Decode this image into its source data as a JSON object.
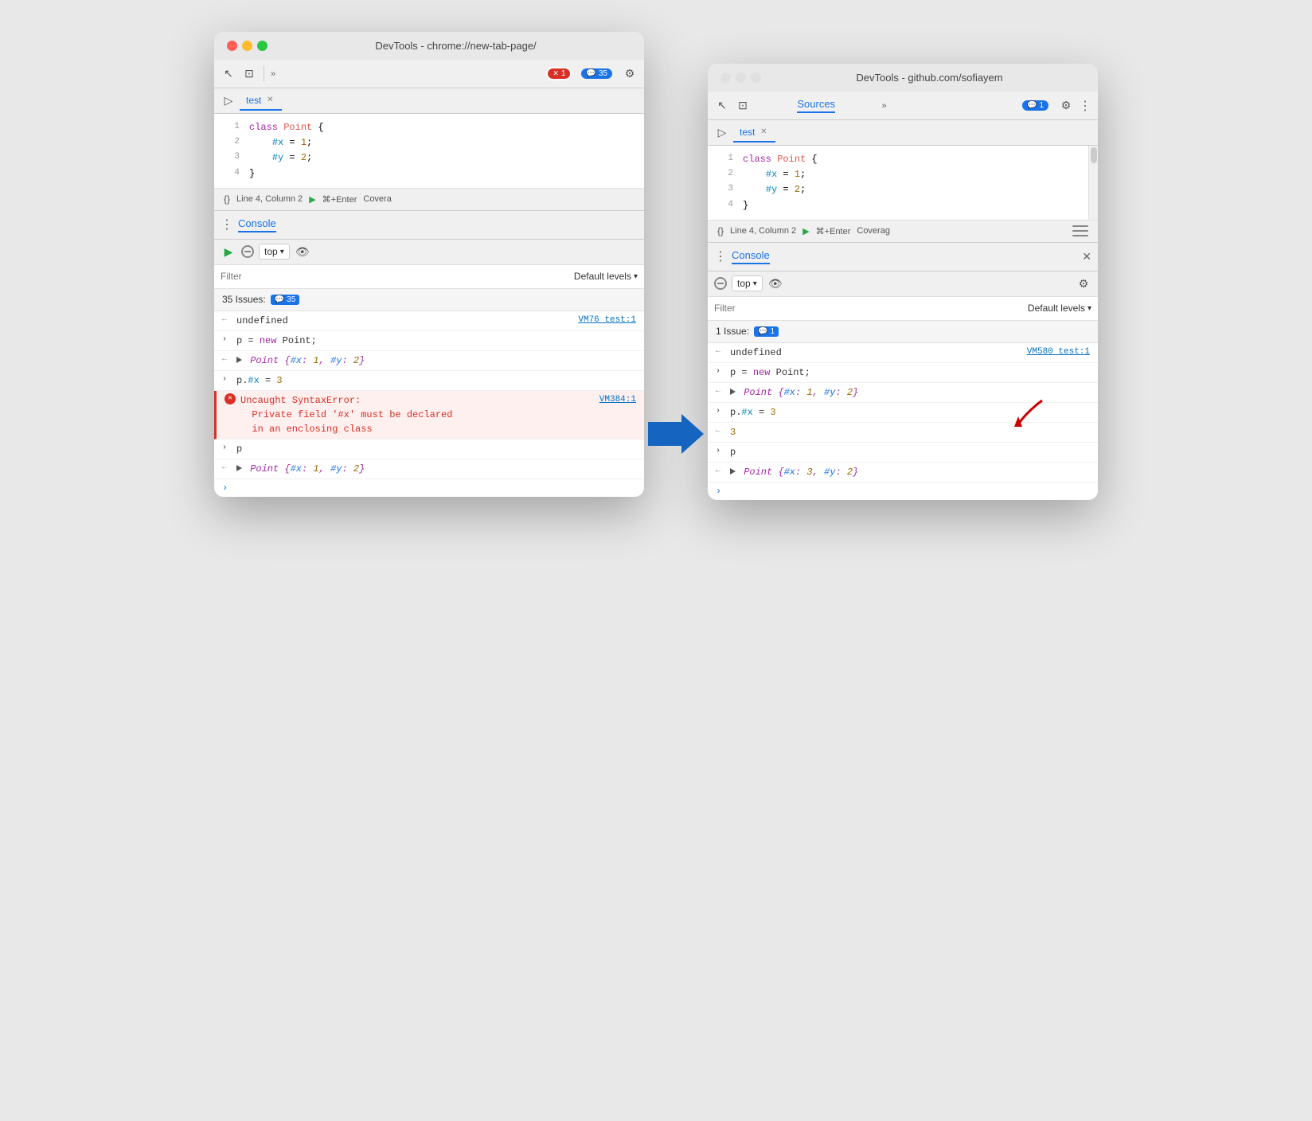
{
  "window1": {
    "title": "DevTools - chrome://new-tab-page/",
    "tab": "test",
    "toolbar": {
      "issues_count": "1",
      "console_count": "35",
      "issues_badge": "35"
    },
    "code": {
      "lines": [
        {
          "num": "1",
          "content": "class Point {",
          "type": "class"
        },
        {
          "num": "2",
          "content": "    #x = 1;",
          "type": "prop"
        },
        {
          "num": "3",
          "content": "    #y = 2;",
          "type": "prop"
        },
        {
          "num": "4",
          "content": "}",
          "type": "normal"
        }
      ]
    },
    "status_bar": {
      "text": "Line 4, Column 2",
      "run_label": "⌘+Enter",
      "coverage": "Covera"
    },
    "console": {
      "title": "Console",
      "top_label": "top",
      "filter_placeholder": "Filter",
      "default_levels": "Default levels",
      "issues_count": "35 Issues:",
      "issues_badge": "35",
      "lines": [
        {
          "dir": "←",
          "text": "undefined",
          "link": "VM76 test:1",
          "type": "output"
        },
        {
          "dir": "›",
          "text": "p = new Point;",
          "link": "",
          "type": "input"
        },
        {
          "dir": "←",
          "text": "▶ Point {#x: 1, #y: 2}",
          "link": "",
          "type": "output"
        },
        {
          "dir": "›",
          "text": "p.#x = 3",
          "link": "",
          "type": "input"
        },
        {
          "dir": "⊗",
          "text": "Uncaught SyntaxError:\nPrivate field '#x' must be declared\nin an enclosing class",
          "link": "VM384:1",
          "type": "error"
        },
        {
          "dir": "›",
          "text": "p",
          "link": "",
          "type": "input"
        },
        {
          "dir": "←",
          "text": "▶ Point {#x: 1, #y: 2}",
          "link": "",
          "type": "output"
        },
        {
          "dir": "›",
          "text": "",
          "link": "",
          "type": "prompt"
        }
      ]
    }
  },
  "window2": {
    "title": "DevTools - github.com/sofiayem",
    "sources_tab": "Sources",
    "tab": "test",
    "toolbar": {
      "console_count": "1"
    },
    "code": {
      "lines": [
        {
          "num": "1",
          "content": "class Point {",
          "type": "class"
        },
        {
          "num": "2",
          "content": "    #x = 1;",
          "type": "prop"
        },
        {
          "num": "3",
          "content": "    #y = 2;",
          "type": "prop"
        },
        {
          "num": "4",
          "content": "}",
          "type": "normal"
        }
      ]
    },
    "status_bar": {
      "text": "Line 4, Column 2",
      "run_label": "⌘+Enter",
      "coverage": "Coverag"
    },
    "console": {
      "title": "Console",
      "top_label": "top",
      "filter_placeholder": "Filter",
      "default_levels": "Default levels",
      "issues_count": "1 Issue:",
      "issues_badge": "1",
      "lines": [
        {
          "dir": "←",
          "text": "undefined",
          "link": "VM580 test:1",
          "type": "output"
        },
        {
          "dir": "›",
          "text": "p = new Point;",
          "link": "",
          "type": "input"
        },
        {
          "dir": "←",
          "text": "▶ Point {#x: 1, #y: 2}",
          "link": "",
          "type": "output"
        },
        {
          "dir": "›",
          "text": "p.#x = 3",
          "link": "",
          "type": "input"
        },
        {
          "dir": "←",
          "text": "3",
          "link": "",
          "type": "output"
        },
        {
          "dir": "›",
          "text": "p",
          "link": "",
          "type": "input"
        },
        {
          "dir": "←",
          "text": "▶ Point {#x: 3, #y: 2}",
          "link": "",
          "type": "output"
        },
        {
          "dir": "›",
          "text": "",
          "link": "",
          "type": "prompt"
        }
      ]
    }
  },
  "icons": {
    "cursor": "↖",
    "layers": "⊡",
    "chevron": "»",
    "gear": "⚙",
    "dots": "⋮",
    "eye": "👁",
    "close": "✕",
    "play": "▶",
    "braces": "{}",
    "expand": "⊞",
    "no_entry": "🚫"
  }
}
